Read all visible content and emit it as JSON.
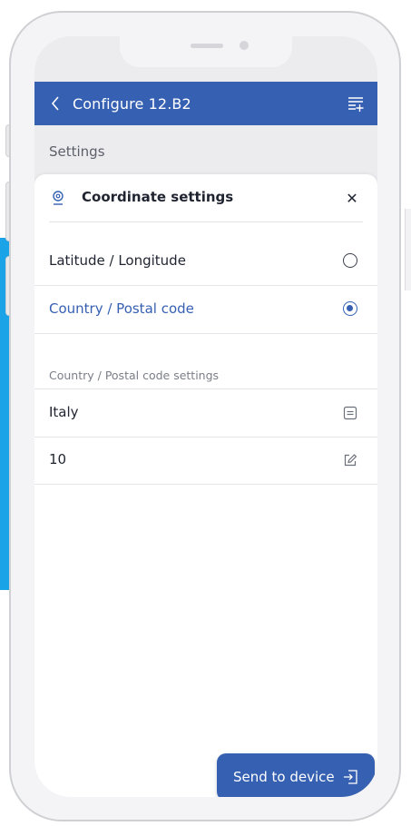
{
  "appbar": {
    "title": "Configure 12.B2",
    "back_icon": "chevron-left-icon",
    "menu_icon": "list-add-icon"
  },
  "page": {
    "section_title": "Settings"
  },
  "sheet": {
    "title": "Coordinate settings",
    "title_icon": "location-pin-icon",
    "close_label": "✕",
    "options": [
      {
        "label": "Latitude / Longitude",
        "selected": false
      },
      {
        "label": "Country / Postal code",
        "selected": true
      }
    ],
    "sub_section_title": "Country / Postal code settings",
    "fields": [
      {
        "value": "Italy",
        "icon": "dropdown-list-icon"
      },
      {
        "value": "10",
        "icon": "edit-icon"
      }
    ]
  },
  "actions": {
    "send_label": "Send to device",
    "send_icon": "send-to-device-icon"
  },
  "colors": {
    "primary": "#3660b2",
    "accent_stripe": "#1aa3e6",
    "text": "#1f2430",
    "muted": "#7a7e87"
  }
}
